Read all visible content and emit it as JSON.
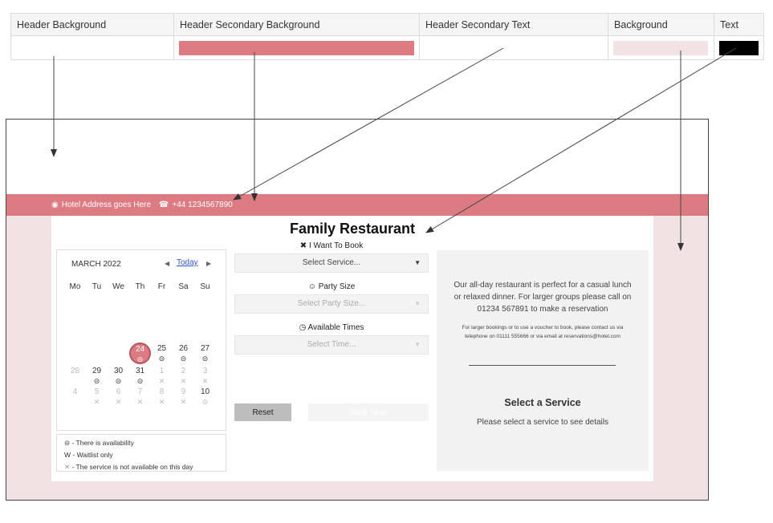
{
  "legend": {
    "headers": [
      "Header Background",
      "Header Secondary Background",
      "Header Secondary Text",
      "Background",
      "Text"
    ],
    "swatches": {
      "header_background": "#ffffff",
      "header_secondary_background": "#dd7b83",
      "header_secondary_text": "#ffffff",
      "background": "#f1e3e4",
      "text": "#000000"
    }
  },
  "preview": {
    "address": "Hotel Address goes Here",
    "phone": "+44 1234567890",
    "title": "Family Restaurant",
    "calendar": {
      "month": "MARCH 2022",
      "today": "Today",
      "weekdays": [
        "Mo",
        "Tu",
        "We",
        "Th",
        "Fr",
        "Sa",
        "Su"
      ],
      "row1": [
        "24",
        "25",
        "26",
        "27"
      ],
      "row2": [
        "28",
        "29",
        "30",
        "31",
        "1",
        "2",
        "3"
      ],
      "row3": [
        "4",
        "5",
        "6",
        "7",
        "8",
        "9",
        "10"
      ],
      "key": [
        "- There is availability",
        "W - Waitlist only",
        "- The service is not available on this day"
      ]
    },
    "form": {
      "service_label": "I Want To Book",
      "service_value": "Select Service...",
      "party_label": "Party Size",
      "party_value": "Select Party Size...",
      "time_label": "Available Times",
      "time_value": "Select Time...",
      "reset": "Reset",
      "book": "Book Now"
    },
    "info": {
      "description": "Our all-day restaurant is perfect for a casual lunch or relaxed dinner. For larger groups please call on 01234 567891 to make a reservation",
      "small": "For larger bookings or to use a voucher to book, please contact us via telephone on 01111 555666 or via email at reservations@hotel.com",
      "heading": "Select a Service",
      "sub": "Please select a service to see details"
    }
  }
}
